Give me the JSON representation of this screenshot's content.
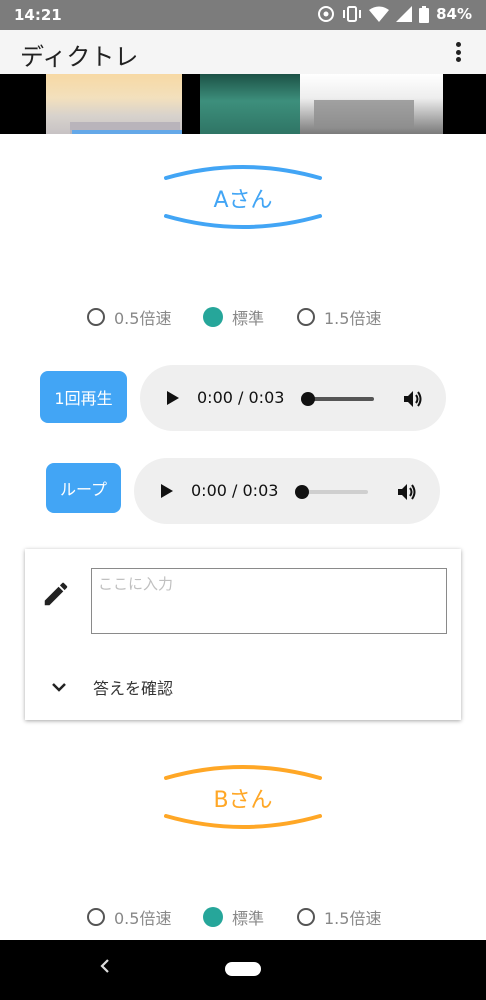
{
  "status_bar": {
    "time": "14:21",
    "battery_level": "84%",
    "icons": [
      "sync-icon",
      "vibrate-icon",
      "wifi-icon",
      "signal-icon",
      "battery-icon"
    ]
  },
  "app_bar": {
    "title": "ディクトレ",
    "menu_icon": "more-vert-icon"
  },
  "speaker_a": {
    "name": "Aさん",
    "color": "#42a5f5",
    "speed_options": [
      {
        "label": "0.5倍速",
        "selected": false
      },
      {
        "label": "標準",
        "selected": true
      },
      {
        "label": "1.5倍速",
        "selected": false
      }
    ],
    "play_once_label": "1回再生",
    "loop_label": "ループ",
    "player_once": {
      "time": "0:00 / 0:03",
      "progress": 0
    },
    "player_loop": {
      "time": "0:00 / 0:03",
      "progress": 0
    }
  },
  "answer_card": {
    "input_value": "",
    "input_placeholder": "ここに入力",
    "confirm_label": "答えを確認",
    "icons": [
      "pencil-icon",
      "chevron-down-icon"
    ]
  },
  "speaker_b": {
    "name": "Bさん",
    "color": "#ffa726",
    "speed_options": [
      {
        "label": "0.5倍速",
        "selected": false
      },
      {
        "label": "標準",
        "selected": true
      },
      {
        "label": "1.5倍速",
        "selected": false
      }
    ]
  },
  "accent_color": "#26a69a",
  "nav_bar": {
    "back_icon": "back-icon",
    "home_icon": "home-pill-icon"
  }
}
